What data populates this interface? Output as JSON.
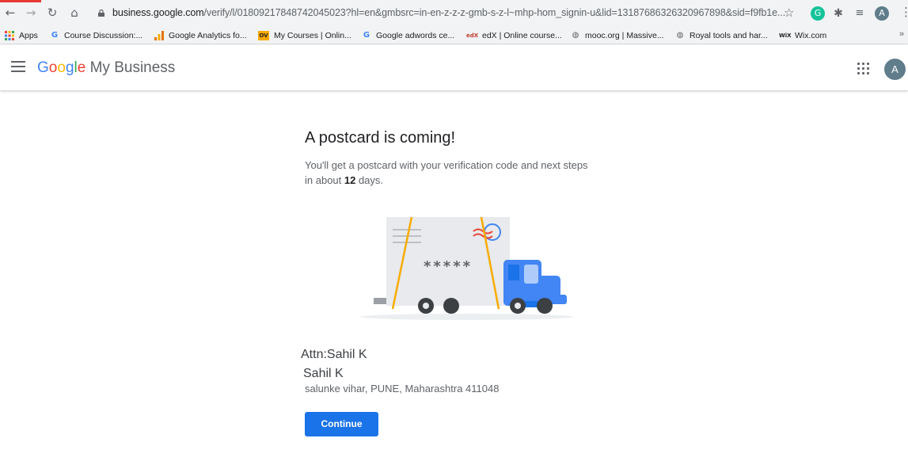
{
  "browser": {
    "url_host": "business.google.com",
    "url_path": "/verify/l/01809217848742045023?hl=en&gmbsrc=in-en-z-z-z-gmb-s-z-l~mhp-hom_signin-u&lid=13187686326320967898&sid=f9fb1e...",
    "profile_initial": "A"
  },
  "bookmarks": [
    {
      "label": "Apps",
      "icon": "apps-grid-icon"
    },
    {
      "label": "Course Discussion:...",
      "icon": "google-icon"
    },
    {
      "label": "Google Analytics fo...",
      "icon": "analytics-icon"
    },
    {
      "label": "My Courses | Onlin...",
      "icon": "ov-icon"
    },
    {
      "label": "Google adwords ce...",
      "icon": "google-icon"
    },
    {
      "label": "edX | Online course...",
      "icon": "edx-icon"
    },
    {
      "label": "mooc.org | Massive...",
      "icon": "globe-icon"
    },
    {
      "label": "Royal tools and har...",
      "icon": "globe-icon"
    },
    {
      "label": "Wix.com",
      "icon": "wix-icon"
    }
  ],
  "header": {
    "logo_letters": [
      "G",
      "o",
      "o",
      "g",
      "l",
      "e"
    ],
    "logo_colors": [
      "#4285f4",
      "#ea4335",
      "#fbbc05",
      "#4285f4",
      "#34a853",
      "#ea4335"
    ],
    "product": "My Business",
    "avatar_initial": "A"
  },
  "main": {
    "title": "A postcard is coming!",
    "subtext_before": "You'll get a postcard with your verification code and next steps in about ",
    "subtext_days": "12",
    "subtext_after": " days.",
    "postcard_code": "*****",
    "attn": "Attn:Sahil K",
    "name": "Sahil K",
    "address": "salunke vihar, PUNE, Maharashtra 411048",
    "continue_label": "Continue"
  },
  "colors": {
    "accent": "#1a73e8",
    "truck_blue": "#4285f4",
    "ribbon": "#f9ab00"
  }
}
